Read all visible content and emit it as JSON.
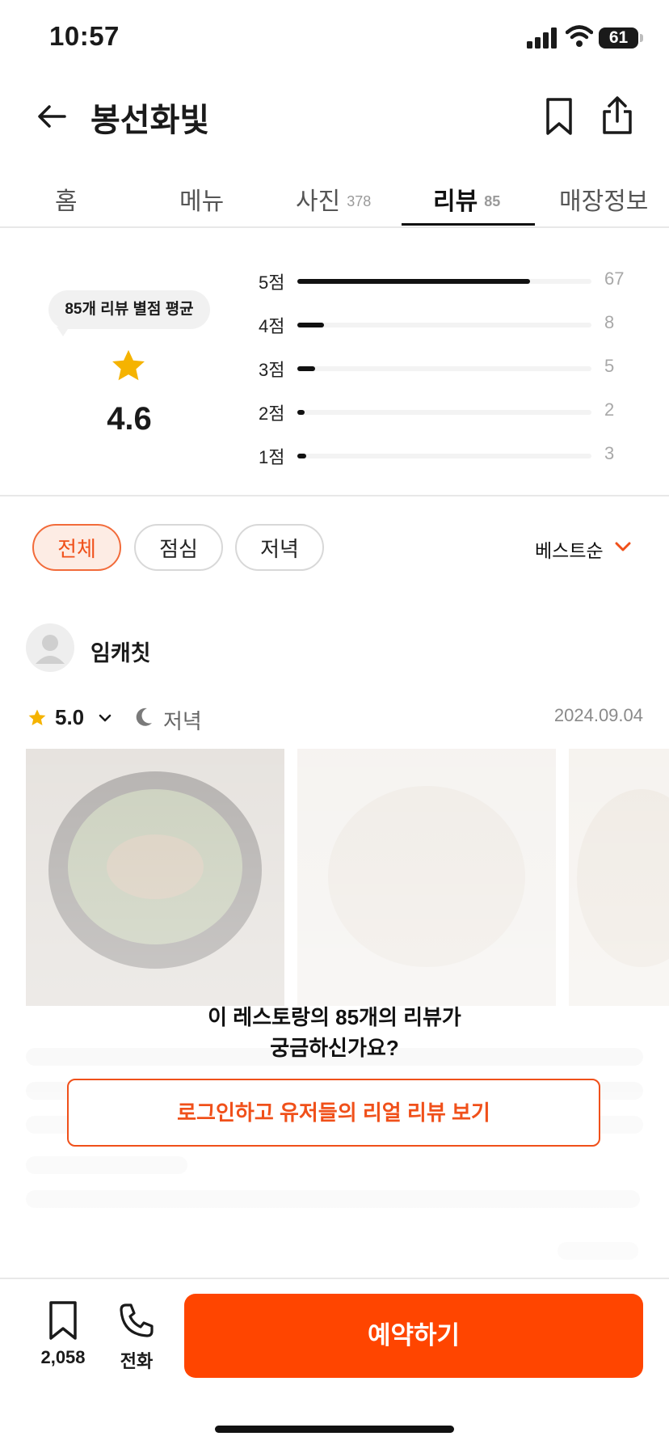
{
  "status_bar": {
    "time": "10:57",
    "battery": "61"
  },
  "header": {
    "title": "봉선화빛",
    "icons": [
      "back-arrow-icon",
      "bookmark-icon",
      "share-icon"
    ]
  },
  "tabs": [
    {
      "label": "홈",
      "count": ""
    },
    {
      "label": "메뉴",
      "count": ""
    },
    {
      "label": "사진",
      "count": "378"
    },
    {
      "label": "리뷰",
      "count": "85"
    },
    {
      "label": "매장정보",
      "count": ""
    }
  ],
  "active_tab": "리뷰",
  "rating_summary": {
    "bubble": "85개 리뷰 별점 평균",
    "average": "4.6",
    "distribution": [
      {
        "label": "5점",
        "count": "67",
        "fill": 0.79
      },
      {
        "label": "4점",
        "count": "8",
        "fill": 0.09
      },
      {
        "label": "3점",
        "count": "5",
        "fill": 0.06
      },
      {
        "label": "2점",
        "count": "2",
        "fill": 0.02
      },
      {
        "label": "1점",
        "count": "3",
        "fill": 0.03
      }
    ]
  },
  "filters": {
    "chips": [
      "전체",
      "점심",
      "저녁"
    ],
    "active": "전체",
    "sort_label": "베스트순"
  },
  "review": {
    "reviewer": "임캐칫",
    "score": "5.0",
    "meal": "저녁",
    "date": "2024.09.04"
  },
  "login_prompt": {
    "line1": "이 레스토랑의 85개의 리뷰가",
    "line2": "궁금하신가요?",
    "button": "로그인하고 유저들의 리얼 리뷰 보기"
  },
  "bottom_bar": {
    "save_count": "2,058",
    "phone_label": "전화",
    "reserve_label": "예약하기"
  },
  "colors": {
    "accent": "#ff4500",
    "accent_text": "#f0501a",
    "star": "#f5b300"
  }
}
